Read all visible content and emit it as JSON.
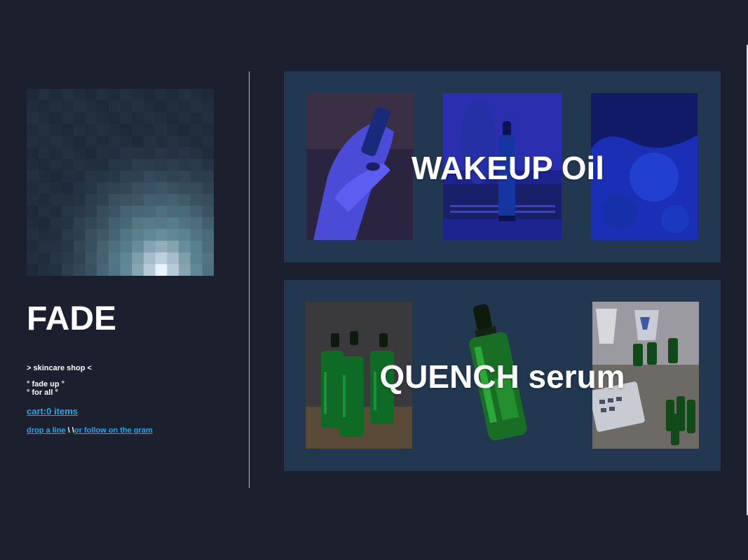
{
  "brand": {
    "title": "FADE",
    "tagline": "> skincare shop <",
    "motto_line1": "° fade up °",
    "motto_line2": "° for all °"
  },
  "links": {
    "cart": "cart:0 items",
    "drop_line": "drop a line",
    "separator": " \\ \\",
    "follow": "or follow on the gram"
  },
  "products": [
    {
      "name": "WAKEUP Oil"
    },
    {
      "name": "QUENCH serum"
    }
  ],
  "colors": {
    "background": "#1c1f2e",
    "card": "#223750",
    "link": "#29a3e6",
    "text": "#ffffff"
  }
}
